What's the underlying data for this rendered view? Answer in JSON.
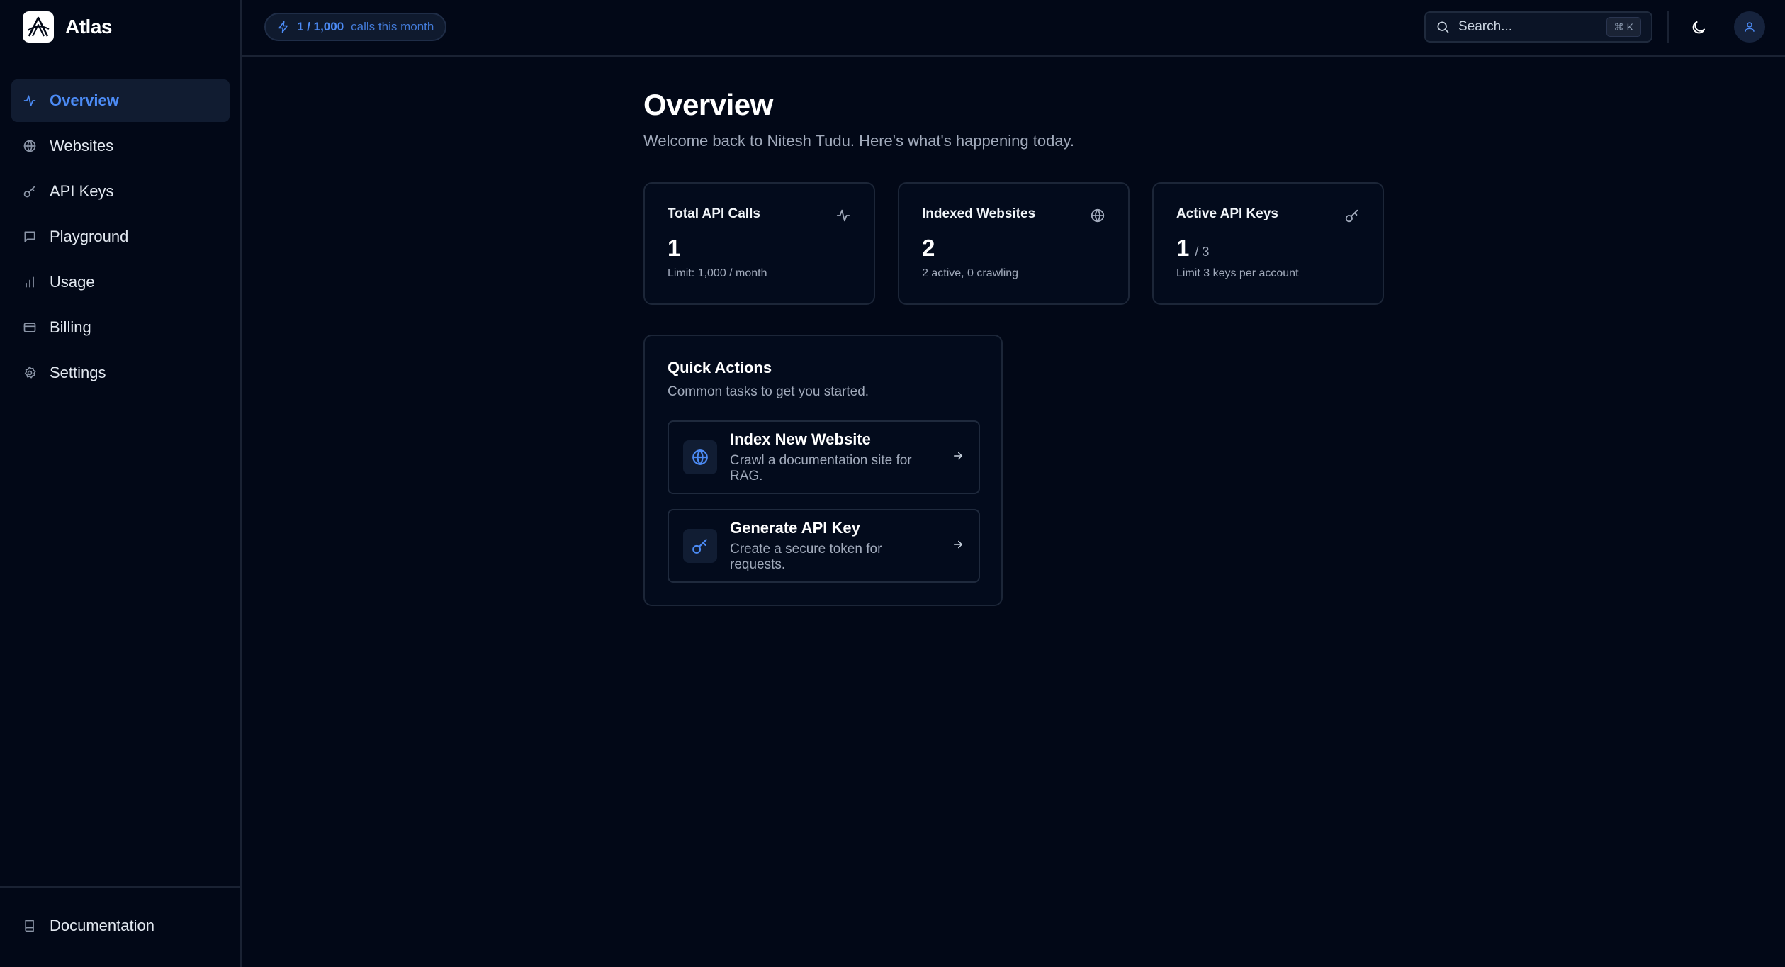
{
  "app": {
    "name": "Atlas"
  },
  "sidebar": {
    "items": [
      {
        "label": "Overview",
        "icon": "activity-icon",
        "active": true
      },
      {
        "label": "Websites",
        "icon": "globe-icon"
      },
      {
        "label": "API Keys",
        "icon": "key-icon"
      },
      {
        "label": "Playground",
        "icon": "message-square-icon"
      },
      {
        "label": "Usage",
        "icon": "bar-chart-icon"
      },
      {
        "label": "Billing",
        "icon": "credit-card-icon"
      },
      {
        "label": "Settings",
        "icon": "gear-icon"
      }
    ],
    "footer": {
      "label": "Documentation",
      "icon": "book-icon"
    }
  },
  "topbar": {
    "usage_count": "1 / 1,000",
    "usage_text": "calls this month",
    "search_placeholder": "Search...",
    "search_shortcut_symbol": "⌘",
    "search_shortcut_key": "K"
  },
  "page": {
    "title": "Overview",
    "subtitle": "Welcome back to Nitesh Tudu. Here's what's happening today."
  },
  "stats": [
    {
      "title": "Total API Calls",
      "value": "1",
      "suffix": "",
      "note": "Limit: 1,000 / month",
      "icon": "activity-icon"
    },
    {
      "title": "Indexed Websites",
      "value": "2",
      "suffix": "",
      "note": "2 active, 0 crawling",
      "icon": "globe-icon"
    },
    {
      "title": "Active API Keys",
      "value": "1",
      "suffix": "/ 3",
      "note": "Limit 3 keys per account",
      "icon": "key-icon"
    }
  ],
  "quick_actions": {
    "title": "Quick Actions",
    "subtitle": "Common tasks to get you started.",
    "actions": [
      {
        "title": "Index New Website",
        "description": "Crawl a documentation site for RAG.",
        "icon": "globe-icon"
      },
      {
        "title": "Generate API Key",
        "description": "Create a secure token for requests.",
        "icon": "key-icon"
      }
    ]
  },
  "colors": {
    "background": "#020817",
    "accent": "#4c8bf5",
    "border": "#1c2638",
    "muted_text": "#a1aabb"
  }
}
